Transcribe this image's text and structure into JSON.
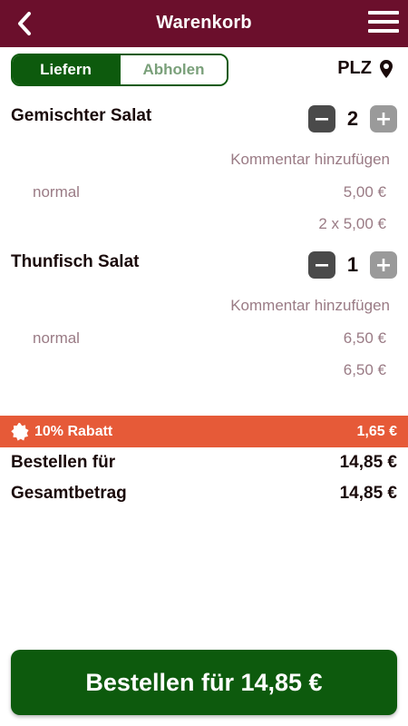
{
  "header": {
    "title": "Warenkorb",
    "back_icon": "chevron-left-icon",
    "menu_icon": "hamburger-menu-icon"
  },
  "mode_toggle": {
    "deliver_label": "Liefern",
    "pickup_label": "Abholen",
    "selected": "Liefern"
  },
  "location": {
    "label": "PLZ",
    "icon": "map-pin-icon"
  },
  "cart": {
    "items": [
      {
        "name": "Gemischter Salat",
        "quantity": "2",
        "comment_label": "Kommentar hinzufügen",
        "variant": "normal",
        "unit_price": "5,00 €",
        "line_total": "2 x 5,00 €"
      },
      {
        "name": "Thunfisch Salat",
        "quantity": "1",
        "comment_label": "Kommentar hinzufügen",
        "variant": "normal",
        "unit_price": "6,50 €",
        "line_total": "6,50 €"
      }
    ]
  },
  "discount": {
    "label": "10% Rabatt",
    "amount": "1,65 €",
    "icon": "badge-icon"
  },
  "summary": {
    "order_for_label": "Bestellen für",
    "order_for_value": "14,85 €",
    "total_label": "Gesamtbetrag",
    "total_value": "14,85 €"
  },
  "order_button": {
    "label": "Bestellen für 14,85 €"
  },
  "colors": {
    "header": "#6b0f2c",
    "primary_green": "#0d5a0d",
    "discount": "#e65a38",
    "muted_text": "#9a7b85"
  }
}
